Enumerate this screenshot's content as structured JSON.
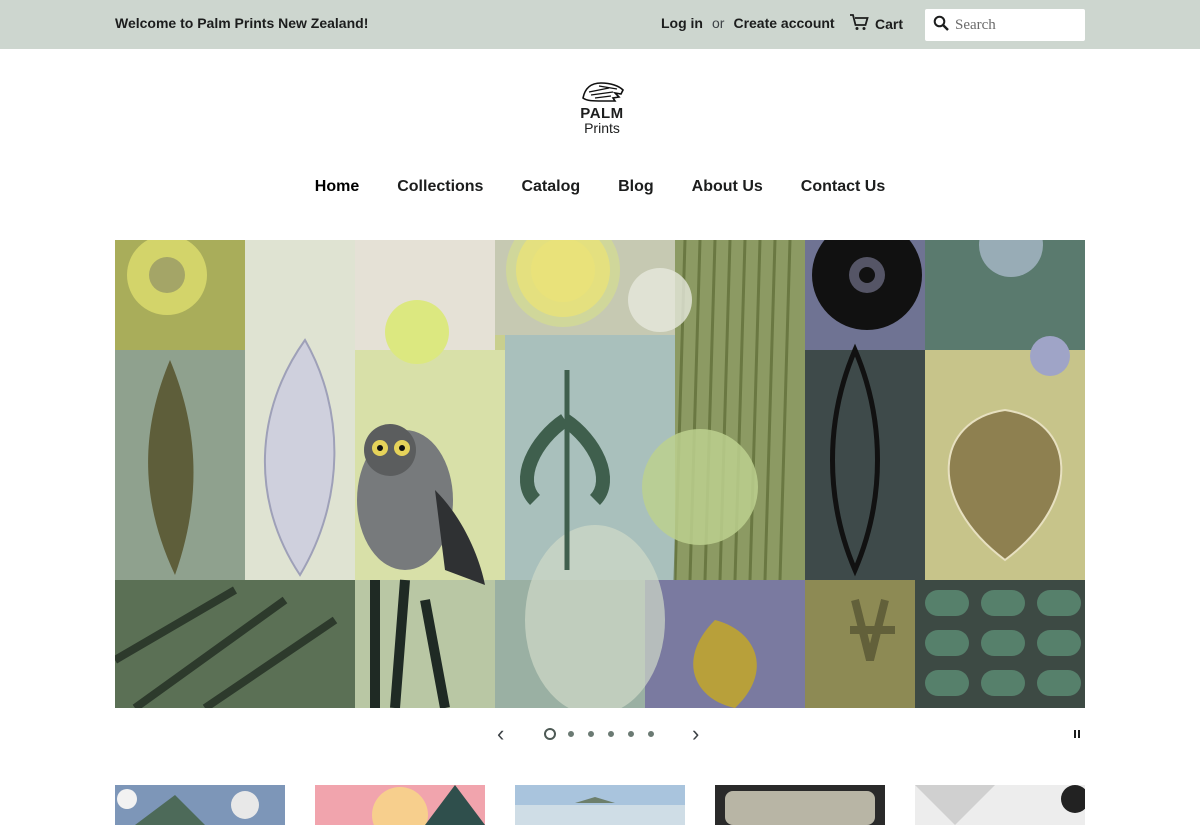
{
  "header": {
    "welcome": "Welcome to Palm Prints New Zealand!",
    "login": "Log in",
    "or": "or",
    "create_account": "Create account",
    "cart": "Cart",
    "search_placeholder": "Search"
  },
  "logo": {
    "line1": "PALM",
    "line2": "Prints"
  },
  "nav": {
    "items": [
      {
        "label": "Home"
      },
      {
        "label": "Collections"
      },
      {
        "label": "Catalog"
      },
      {
        "label": "Blog"
      },
      {
        "label": "About Us"
      },
      {
        "label": "Contact Us"
      }
    ]
  },
  "slider": {
    "prev_icon": "chevron-left-icon",
    "next_icon": "chevron-right-icon",
    "slide_count": 6,
    "active_index": 0,
    "pause_icon": "pause-icon"
  },
  "colors": {
    "topbar": "#cdd6cf",
    "text": "#1c1d1d"
  }
}
